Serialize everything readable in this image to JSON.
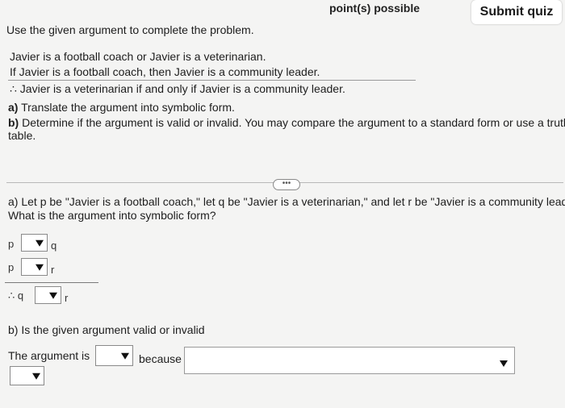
{
  "header": {
    "points_label": "point(s) possible",
    "submit_label": "Submit quiz"
  },
  "problem": {
    "instruction": "Use the given argument to complete the problem.",
    "premise1": "Javier is a football coach or Javier is a veterinarian.",
    "premise2": "If Javier is a football coach, then Javier is a community leader.",
    "conclusion": "∴ Javier is a veterinarian if and only if Javier is a community leader.",
    "part_a_label": "a)",
    "part_a_text": "Translate the argument into symbolic form.",
    "part_b_label": "b)",
    "part_b_text": "Determine if the argument is valid or invalid. You may compare the argument to a standard form or use a truth",
    "part_b_text2": "table."
  },
  "expand_button": "•••",
  "answer_a": {
    "line1": "a) Let p be \"Javier is a football coach,\" let q be \"Javier is a veterinarian,\" and let r be \"Javier is a community leader.\"",
    "line2": "What is the argument into symbolic form?",
    "rows": [
      {
        "left": "p",
        "right": "q"
      },
      {
        "left": "p",
        "right": "r"
      },
      {
        "left": "∴ q",
        "right": "r"
      }
    ]
  },
  "answer_b": {
    "question": "b) Is the given argument valid or invalid",
    "prefix": "The argument is",
    "because": "because"
  }
}
